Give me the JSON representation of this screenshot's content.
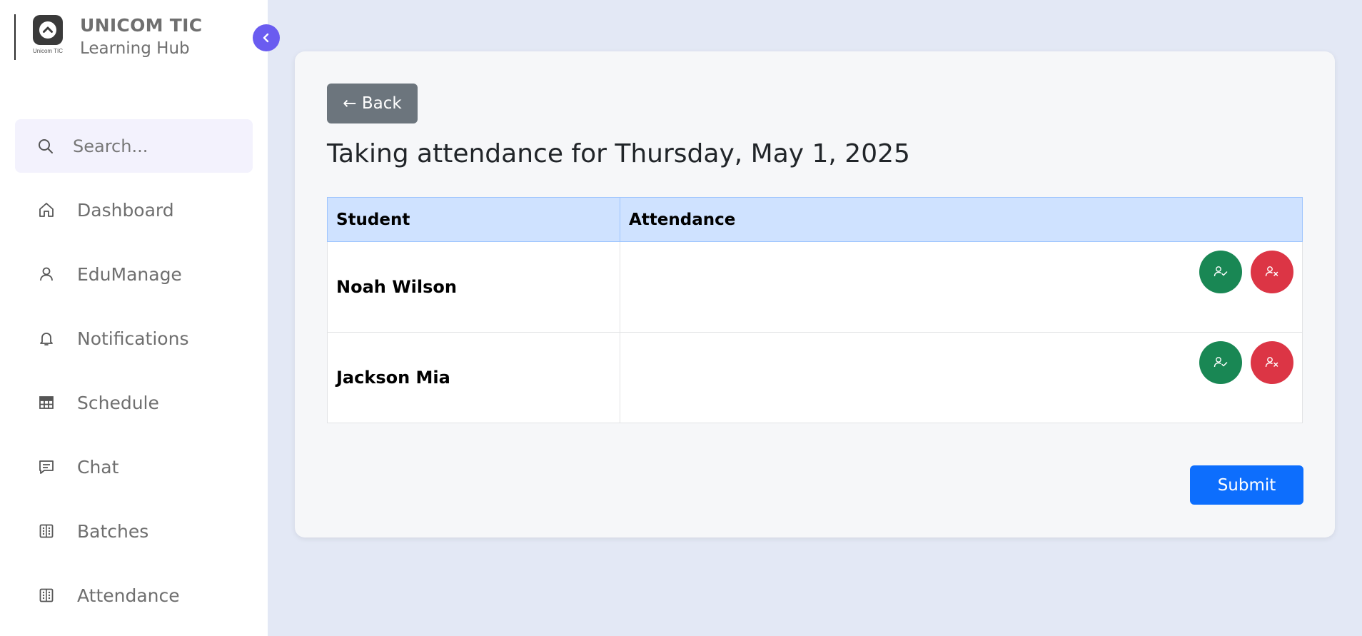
{
  "brand": {
    "title": "UNICOM TIC",
    "subtitle": "Learning Hub",
    "logo_caption": "Unicom TIC"
  },
  "search": {
    "placeholder": "Search..."
  },
  "nav": {
    "items": [
      {
        "label": "Dashboard",
        "icon": "home-icon"
      },
      {
        "label": "EduManage",
        "icon": "user-icon"
      },
      {
        "label": "Notifications",
        "icon": "bell-icon"
      },
      {
        "label": "Schedule",
        "icon": "grid-icon"
      },
      {
        "label": "Chat",
        "icon": "chat-icon"
      },
      {
        "label": "Batches",
        "icon": "batches-icon"
      },
      {
        "label": "Attendance",
        "icon": "attendance-icon"
      }
    ]
  },
  "main": {
    "back_label": "← Back",
    "title": "Taking attendance for Thursday, May 1, 2025",
    "table": {
      "headers": [
        "Student",
        "Attendance"
      ],
      "rows": [
        {
          "student": "Noah Wilson"
        },
        {
          "student": "Jackson Mia"
        }
      ]
    },
    "submit_label": "Submit"
  },
  "colors": {
    "accent": "#6a5cf0",
    "present": "#198754",
    "absent": "#dc3545",
    "primary": "#0d6efd",
    "secondary": "#6c757d",
    "table_header": "#cfe2ff"
  }
}
